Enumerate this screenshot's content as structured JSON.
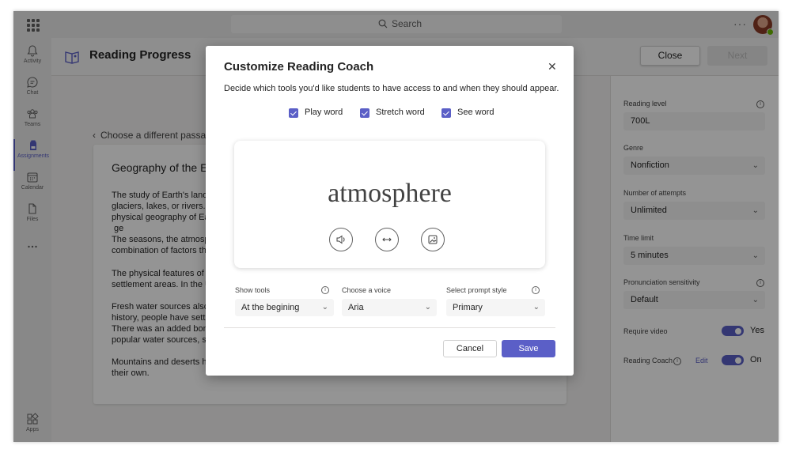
{
  "topbar": {
    "search_placeholder": "Search",
    "more_label": "···"
  },
  "rail": {
    "items": [
      {
        "label": "Activity",
        "icon": "bell-icon"
      },
      {
        "label": "Chat",
        "icon": "chat-icon"
      },
      {
        "label": "Teams",
        "icon": "teams-icon"
      },
      {
        "label": "Assignments",
        "icon": "backpack-icon",
        "active": true
      },
      {
        "label": "Calendar",
        "icon": "calendar-icon"
      },
      {
        "label": "Files",
        "icon": "file-icon"
      },
      {
        "label": "",
        "icon": "more-icon"
      },
      {
        "label": "Apps",
        "icon": "apps-icon"
      }
    ]
  },
  "page": {
    "title": "Reading Progress",
    "close_label": "Close",
    "next_label": "Next"
  },
  "content": {
    "back_link": "Choose a different passage",
    "passage_title": "Geography of the Ea",
    "paragraphs": [
      "The study of Earth's landfor",
      "glaciers, lakes, or rivers. Lan",
      "physical geography of Earth",
      " ge",
      "The seasons, the atmosphe",
      "combination of factors that",
      "The physical features of a r",
      "settlement areas. In the U.S",
      "Fresh water sources also in",
      "history, people have settled",
      "There was an added bonus,",
      "popular water sources, such",
      "Mountains and deserts hav",
      "their own."
    ]
  },
  "settings": {
    "reading_level_label": "Reading level",
    "reading_level_value": "700L",
    "genre_label": "Genre",
    "genre_value": "Nonfiction",
    "attempts_label": "Number of attempts",
    "attempts_value": "Unlimited",
    "time_limit_label": "Time limit",
    "time_limit_value": "5 minutes",
    "sensitivity_label": "Pronunciation sensitivity",
    "sensitivity_value": "Default",
    "require_video_label": "Require video",
    "require_video_state": "Yes",
    "reading_coach_label": "Reading Coach",
    "reading_coach_edit": "Edit",
    "reading_coach_state": "On",
    "info_glyph": "i"
  },
  "modal": {
    "title": "Customize Reading Coach",
    "description": "Decide which tools you'd like students to have access to and when they should appear.",
    "checkboxes": [
      {
        "label": "Play word",
        "checked": true
      },
      {
        "label": "Stretch word",
        "checked": true
      },
      {
        "label": "See word",
        "checked": true
      }
    ],
    "preview_word": "atmosphere",
    "show_tools_label": "Show tools",
    "show_tools_value": "At the begining",
    "voice_label": "Choose a voice",
    "voice_value": "Aria",
    "prompt_style_label": "Select prompt style",
    "prompt_style_value": "Primary",
    "cancel_label": "Cancel",
    "save_label": "Save",
    "close_glyph": "✕"
  },
  "colors": {
    "accent": "#5b5fc7",
    "presence": "#6bb700"
  }
}
